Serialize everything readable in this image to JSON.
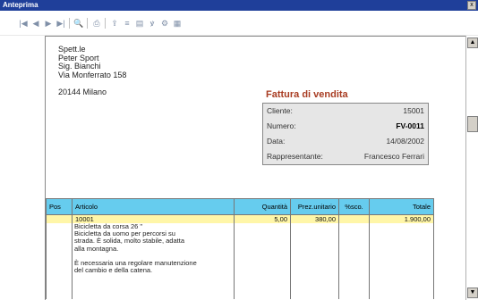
{
  "window": {
    "title": "Anteprima",
    "close_glyph": "x"
  },
  "toolbar": {
    "buttons": [
      {
        "name": "first-page-icon",
        "glyph": "|◀"
      },
      {
        "name": "prev-page-icon",
        "glyph": "◀"
      },
      {
        "name": "next-page-icon",
        "glyph": "▶"
      },
      {
        "name": "last-page-icon",
        "glyph": "▶|"
      },
      {
        "name": "zoom-icon",
        "glyph": "🔍"
      },
      {
        "name": "print-icon",
        "glyph": "⎙"
      },
      {
        "name": "export-icon",
        "glyph": "⇪"
      },
      {
        "name": "export-text-icon",
        "glyph": "≡"
      },
      {
        "name": "export-table-icon",
        "glyph": "▤"
      },
      {
        "name": "export-special-icon",
        "glyph": "ꝟ"
      },
      {
        "name": "settings-icon",
        "glyph": "⚙"
      },
      {
        "name": "page-setup-icon",
        "glyph": "▦"
      }
    ]
  },
  "address": {
    "lines": [
      "Spett.le",
      "Peter Sport",
      "Sig. Bianchi",
      "Via Monferrato 158"
    ],
    "city": "20144 Milano"
  },
  "invoice": {
    "title": "Fattura di vendita",
    "rows": [
      {
        "label": "Cliente:",
        "value": "15001"
      },
      {
        "label": "Numero:",
        "value": "FV-0011"
      },
      {
        "label": "Data:",
        "value": "14/08/2002"
      },
      {
        "label": "Rappresentante:",
        "value": "Francesco Ferrari"
      }
    ]
  },
  "table": {
    "headers": [
      "Pos",
      "Articolo",
      "Quantità",
      "Prez.unitario",
      "%sco.",
      "Totale"
    ],
    "row": {
      "pos": "",
      "articolo": "10001",
      "quantita": "5,00",
      "prezzo": "380,00",
      "sconto": "",
      "totale": "1.900,00",
      "description": [
        "Bicicletta da corsa 26 \"",
        "Bicicletta da uomo per percorsi su",
        "strada. È solida, molto stabile, adatta",
        "alla montagna.",
        "",
        "È necessaria una regolare manutenzione",
        "del cambio e della catena."
      ]
    }
  },
  "scrollbar": {
    "up_glyph": "▲",
    "down_glyph": "▼"
  }
}
